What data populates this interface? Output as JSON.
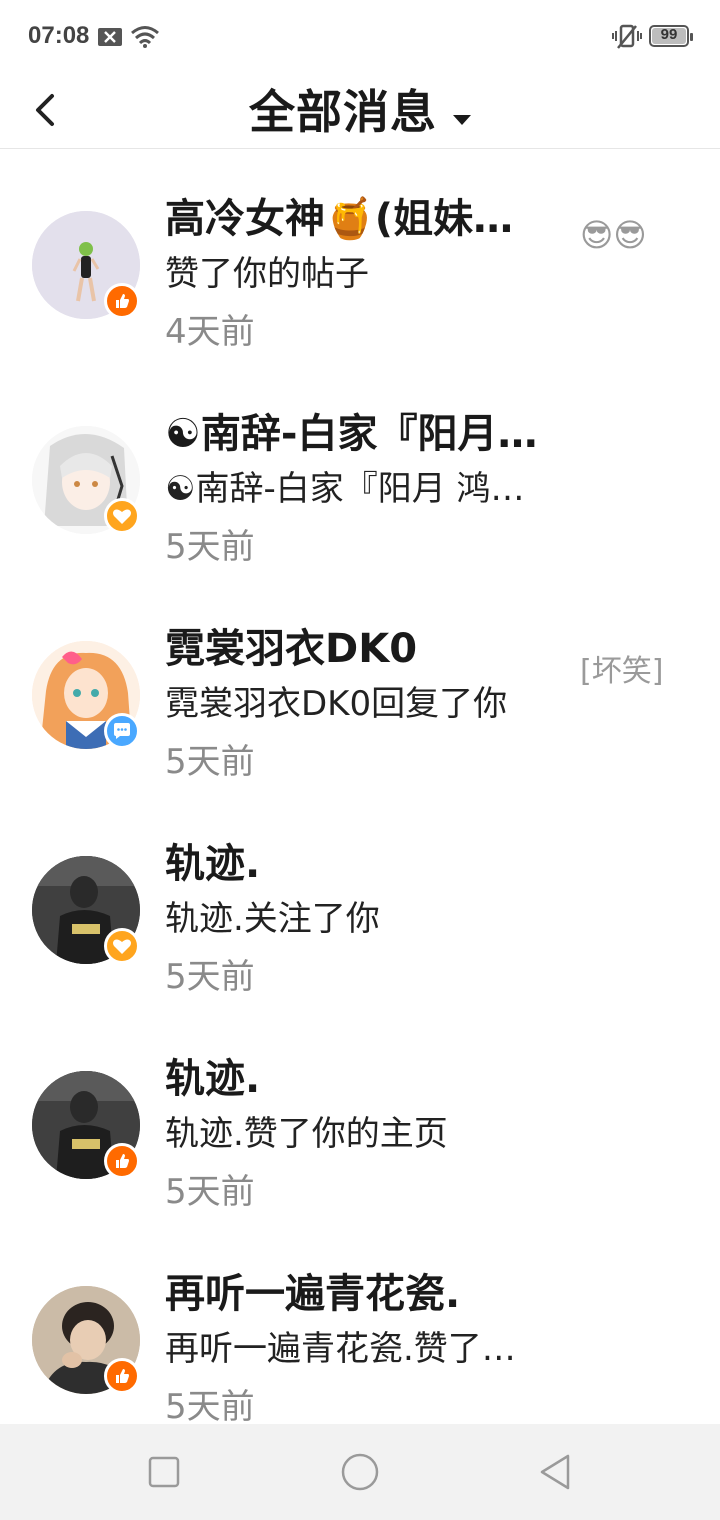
{
  "status_bar": {
    "time": "07:08",
    "battery": "99",
    "icons": [
      "notification-x-icon",
      "wifi-icon",
      "vibrate-icon",
      "battery-icon"
    ]
  },
  "header": {
    "title": "全部消息",
    "back_icon": "back-arrow-icon",
    "dropdown_icon": "caret-down-icon"
  },
  "messages": [
    {
      "name": "高冷女神🍯(姐妹…",
      "desc": "赞了你的帖子",
      "time": "4天前",
      "extra": "😎😎",
      "badge": "like"
    },
    {
      "name": "☯南辞-白家『阳月…",
      "desc": "☯南辞-白家『阳月 鸿…",
      "time": "5天前",
      "extra": "",
      "badge": "heart"
    },
    {
      "name": "霓裳羽衣DK0",
      "desc": "霓裳羽衣DK0回复了你",
      "time": "5天前",
      "extra": "[坏笑]",
      "badge": "comment"
    },
    {
      "name": "轨迹.",
      "desc": "轨迹.关注了你",
      "time": "5天前",
      "extra": "",
      "badge": "heart"
    },
    {
      "name": "轨迹.",
      "desc": "轨迹.赞了你的主页",
      "time": "5天前",
      "extra": "",
      "badge": "like"
    },
    {
      "name": "再听一遍青花瓷.",
      "desc": "再听一遍青花瓷.赞了…",
      "time": "5天前",
      "extra": "",
      "badge": "like"
    }
  ],
  "colors": {
    "like_badge": "#ff6a00",
    "heart_badge": "#ffa51e",
    "comment_badge": "#4aa8ff",
    "time_text": "#8a8a8a"
  },
  "bottom_nav": {
    "icons": [
      "recent-apps-icon",
      "home-circle-icon",
      "back-triangle-icon"
    ]
  }
}
